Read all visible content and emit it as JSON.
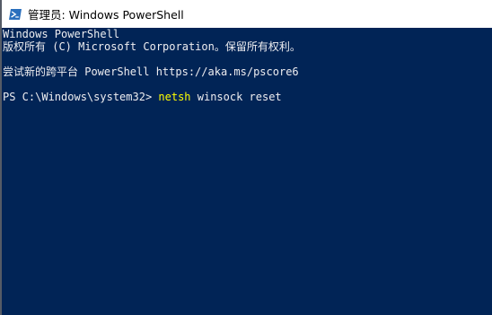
{
  "window": {
    "title": "管理员: Windows PowerShell",
    "icon": "powershell-icon"
  },
  "console": {
    "banner_line1": "Windows PowerShell",
    "banner_line2": "版权所有 (C) Microsoft Corporation。保留所有权利。",
    "tip_line": "尝试新的跨平台 PowerShell https://aka.ms/pscore6",
    "prompt": "PS C:\\Windows\\system32> ",
    "command": "netsh",
    "arguments": " winsock reset"
  },
  "colors": {
    "console_background": "#012456",
    "console_text": "#eeedf0",
    "command_highlight": "#ffff00",
    "titlebar_background": "#ffffff"
  }
}
